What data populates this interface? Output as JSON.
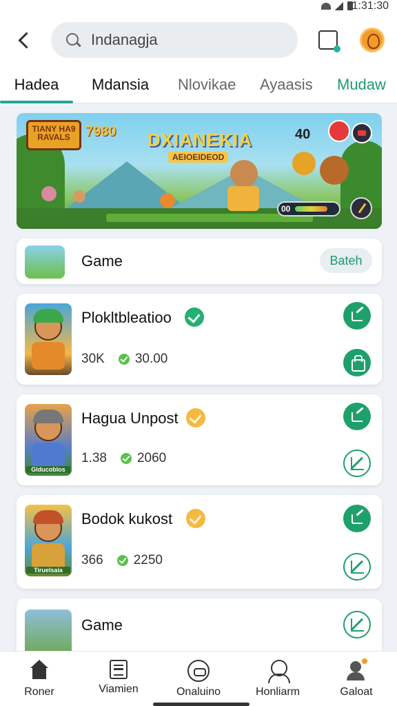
{
  "status": {
    "time": "1:31:30"
  },
  "header": {
    "search_value": "Indanagja"
  },
  "tabs": [
    {
      "label": "Hadea",
      "active": true
    },
    {
      "label": "Mdansia"
    },
    {
      "label": "Nlovikae"
    },
    {
      "label": "Ayaasis"
    },
    {
      "label": "Mudaw"
    }
  ],
  "banner": {
    "logo_text": "TIANY HA9 RAVALS",
    "score": "7980",
    "title": "DXIANEKIA",
    "subtitle": "AEIOEIDEOD",
    "counter": "40",
    "bar_label": "00",
    "bar_fill": 0.75
  },
  "featured": {
    "title": "Game",
    "button": "Bateh"
  },
  "games": [
    {
      "title": "Plokltbleatioo",
      "badge": "verified-green",
      "stat1": "30K",
      "stat2": "30.00",
      "thumb_label": ""
    },
    {
      "title": "Hagua Unpost",
      "badge": "verified-orange",
      "stat1": "1.38",
      "stat2": "2060",
      "thumb_label": "Glducoblos"
    },
    {
      "title": "Bodok kukost",
      "badge": "verified-orange",
      "stat1": "366",
      "stat2": "2250",
      "thumb_label": "Tiruelsaia"
    },
    {
      "title": "Game"
    }
  ],
  "nav": [
    {
      "label": "Roner"
    },
    {
      "label": "Viamien"
    },
    {
      "label": "Onaluino"
    },
    {
      "label": "Honliarm"
    },
    {
      "label": "Galoat"
    }
  ],
  "colors": {
    "accent": "#1ea06b",
    "tab_indicator": "#22a79a",
    "verify_green": "#23b072",
    "verify_orange": "#f5b942"
  }
}
